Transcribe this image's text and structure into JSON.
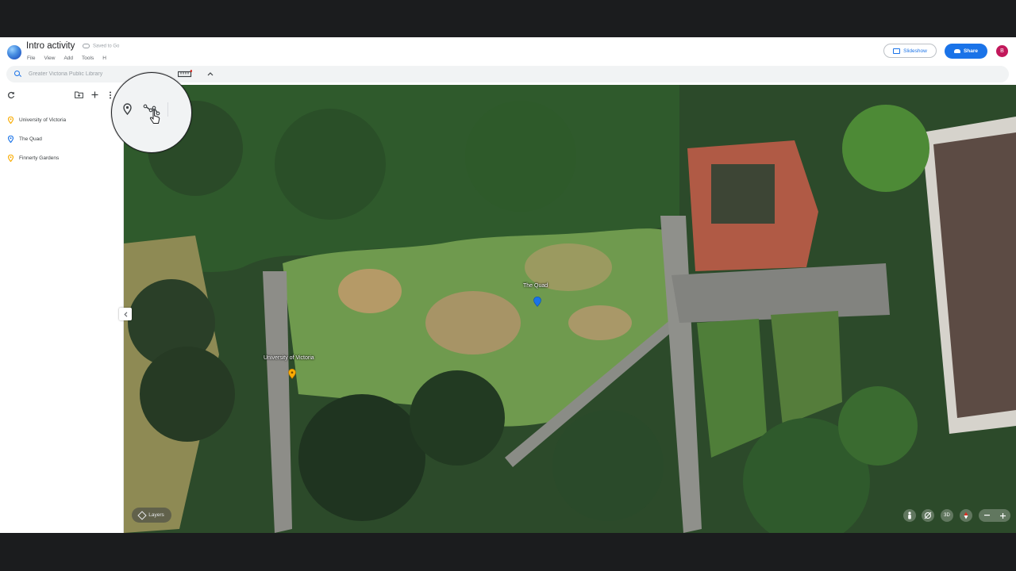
{
  "app": {
    "title": "Intro activity",
    "saved_status": "Saved to Go",
    "menu": [
      "File",
      "View",
      "Add",
      "Tools",
      "H"
    ],
    "slideshow_label": "Slideshow",
    "share_label": "Share",
    "avatar_initial": "B",
    "brand_color": "#1a73e8"
  },
  "toolbar": {
    "search_placeholder": "Greater Victoria Public Library",
    "tools": [
      "add-marker-icon",
      "draw-line-icon",
      "measure-icon"
    ]
  },
  "sidebar": {
    "items": [
      {
        "label": "University of Victoria",
        "color": "#f9ab00"
      },
      {
        "label": "The Quad",
        "color": "#1a73e8"
      },
      {
        "label": "Finnerty Gardens",
        "color": "#f9ab00"
      }
    ]
  },
  "map": {
    "markers": [
      {
        "label": "The Quad",
        "color": "#1a73e8"
      },
      {
        "label": "University of Victoria",
        "color": "#f9ab00"
      }
    ],
    "layers_label": "Layers",
    "view_3d_label": "3D"
  }
}
